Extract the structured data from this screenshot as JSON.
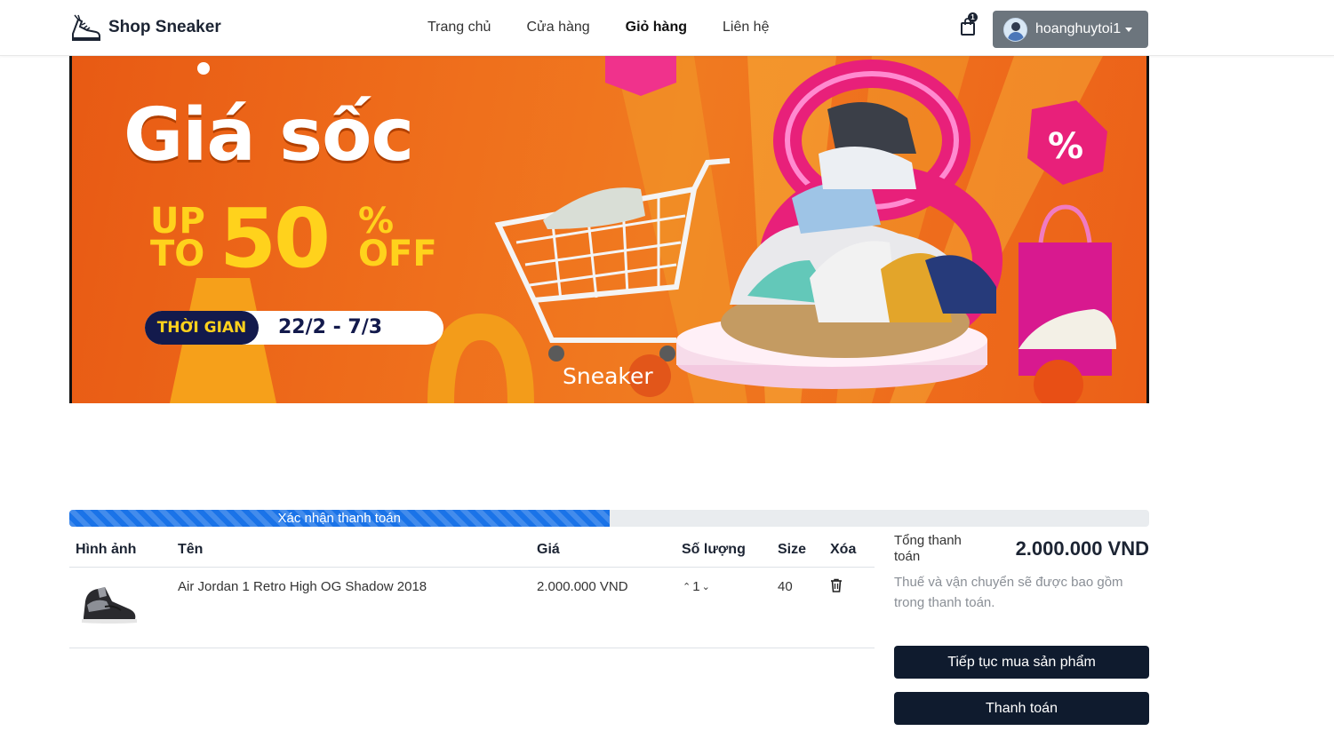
{
  "navbar": {
    "brand": "Shop Sneaker",
    "links": [
      {
        "label": "Trang chủ",
        "active": false
      },
      {
        "label": "Cửa hàng",
        "active": false
      },
      {
        "label": "Giỏ hàng",
        "active": true
      },
      {
        "label": "Liên hệ",
        "active": false
      }
    ],
    "cart_count": "1",
    "username": "hoanghuytoi1"
  },
  "banner": {
    "headline": "Giá sốc",
    "promo_upto_line1": "UP",
    "promo_upto_line2": "TO",
    "promo_value": "50",
    "promo_percent": "%",
    "promo_off": "OFF",
    "time_label": "THỜI GIAN",
    "time_value": "22/2 - 7/3",
    "watermark": "Sneaker"
  },
  "progress": {
    "label": "Xác nhận thanh toán",
    "percent": 50
  },
  "cart": {
    "headers": {
      "image": "Hình ảnh",
      "name": "Tên",
      "price": "Giá",
      "quantity": "Số lượng",
      "size": "Size",
      "remove": "Xóa"
    },
    "items": [
      {
        "name": "Air Jordan 1 Retro High OG Shadow 2018",
        "price": "2.000.000 VND",
        "quantity": "1",
        "size": "40"
      }
    ]
  },
  "summary": {
    "total_label": "Tổng thanh toán",
    "total_value": "2.000.000 VND",
    "note": "Thuế và vận chuyển sẽ được bao gồm trong thanh toán.",
    "continue_label": "Tiếp tục mua sản phẩm",
    "checkout_label": "Thanh toán"
  },
  "colors": {
    "brand_dark": "#0f1b2e",
    "progress_blue": "#1a73e8",
    "banner_orange": "#ec6018",
    "promo_yellow": "#ffd21c",
    "user_button_gray": "#6c757d"
  },
  "icons": [
    "sneaker-logo-icon",
    "shopping-bag-icon",
    "user-avatar-icon",
    "chevron-up-icon",
    "chevron-down-icon",
    "trash-icon"
  ]
}
